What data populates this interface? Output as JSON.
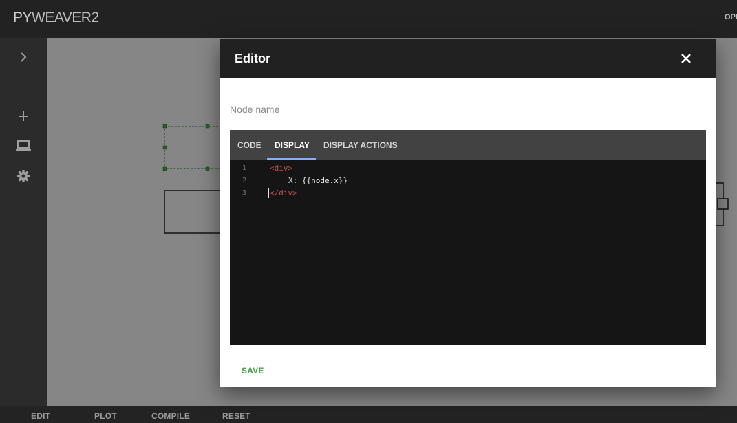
{
  "app": {
    "logo_prefix": "PY",
    "logo_rest": "WEAVER2",
    "top_action": "OPEN"
  },
  "sidebar": {
    "items": [
      {
        "icon": "chevron-right-icon"
      },
      {
        "icon": "plus-icon"
      },
      {
        "icon": "laptop-icon"
      },
      {
        "icon": "gear-icon"
      }
    ]
  },
  "bottombar": {
    "buttons": [
      "EDIT",
      "PLOT",
      "COMPILE",
      "RESET"
    ]
  },
  "dialog": {
    "title": "Editor",
    "node_name_placeholder": "Node name",
    "node_name_value": "",
    "tabs": [
      "CODE",
      "DISPLAY",
      "DISPLAY ACTIONS"
    ],
    "active_tab": "DISPLAY",
    "code_lines": [
      {
        "num": "1",
        "text": "<div>"
      },
      {
        "num": "2",
        "text": "X: {{node.x}}"
      },
      {
        "num": "3",
        "text": "</div>"
      }
    ],
    "save_label": "SAVE"
  },
  "colors": {
    "accent_tab_underline": "#82b1ff",
    "save_green": "#43a047",
    "code_tag": "#c0504d"
  }
}
